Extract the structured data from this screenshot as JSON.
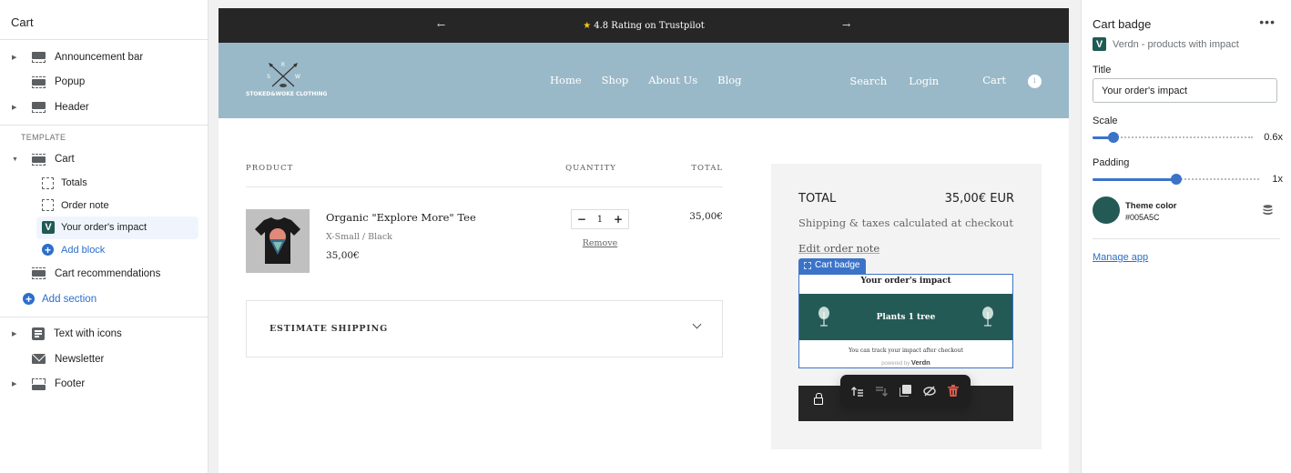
{
  "sidebar": {
    "title": "Cart",
    "header_sections": [
      {
        "label": "Announcement bar",
        "expandable": true,
        "icon": "section-top-icon"
      },
      {
        "label": "Popup",
        "expandable": false,
        "icon": "section-popup-icon"
      },
      {
        "label": "Header",
        "expandable": true,
        "icon": "section-top-icon"
      }
    ],
    "template_label": "TEMPLATE",
    "template_section": {
      "label": "Cart",
      "expanded": true
    },
    "blocks": [
      {
        "label": "Totals",
        "icon": "block-frame-icon"
      },
      {
        "label": "Order note",
        "icon": "block-frame-icon"
      },
      {
        "label": "Your order's impact",
        "icon": "verdn-app-icon",
        "selected": true
      }
    ],
    "add_block": "Add block",
    "cart_recommendations": "Cart recommendations",
    "add_section": "Add section",
    "footer_sections": [
      {
        "label": "Text with icons",
        "expandable": true,
        "icon": "text-icon"
      },
      {
        "label": "Newsletter",
        "expandable": false,
        "icon": "mail-icon"
      },
      {
        "label": "Footer",
        "expandable": true,
        "icon": "section-bottom-icon"
      }
    ]
  },
  "preview": {
    "announcement": {
      "text": "4.8 Rating on Trustpilot",
      "star": "★",
      "prev": "←",
      "next": "→"
    },
    "header": {
      "logo_text": "STOKED&WOKE CLOTHING",
      "logo_letters": {
        "top": "R",
        "left": "S",
        "right": "W"
      },
      "nav_left": [
        "Home",
        "Shop",
        "About Us",
        "Blog"
      ],
      "nav_right": {
        "search": "Search",
        "login": "Login",
        "cart": "Cart",
        "cart_count": "1"
      }
    },
    "cart": {
      "columns": {
        "product": "PRODUCT",
        "quantity": "QUANTITY",
        "total": "TOTAL"
      },
      "items": [
        {
          "name": "Organic \"Explore More\" Tee",
          "variant": "X-Small / Black",
          "price": "35,00€",
          "quantity": "1",
          "minus": "−",
          "plus": "+",
          "remove": "Remove",
          "line_total": "35,00€"
        }
      ],
      "estimate_shipping": "ESTIMATE SHIPPING"
    },
    "summary": {
      "total_label": "TOTAL",
      "total_value": "35,00€ EUR",
      "shipping_note": "Shipping & taxes calculated at checkout",
      "edit_note": "Edit order note",
      "selected_block_tab": "Cart badge",
      "badge": {
        "title": "Your order's impact",
        "impact": "Plants 1 tree",
        "track_note": "You can track your impact after checkout",
        "powered_by": "powered by",
        "brand": "Verdn"
      }
    },
    "block_toolbar": [
      {
        "name": "move-to-parent",
        "icon": "move-up-icon"
      },
      {
        "name": "move-down",
        "icon": "move-down-icon"
      },
      {
        "name": "duplicate",
        "icon": "duplicate-icon"
      },
      {
        "name": "hide",
        "icon": "hide-icon"
      },
      {
        "name": "delete",
        "icon": "trash-icon"
      }
    ]
  },
  "settings": {
    "title": "Cart badge",
    "more": "•••",
    "app_name": "Verdn - products with impact",
    "title_label": "Title",
    "title_value": "Your order's impact",
    "scale_label": "Scale",
    "scale_value": "0.6x",
    "scale_fraction": 0.13,
    "padding_label": "Padding",
    "padding_value": "1x",
    "padding_fraction": 0.5,
    "theme_color_label": "Theme color",
    "theme_color_value": "#005A5C",
    "theme_color_swatch": "#245a56",
    "manage_app": "Manage app"
  },
  "colors": {
    "accent": "#3b73c8",
    "link": "#2c6ecb",
    "header_bg": "#9ab9c8",
    "announcement_bg": "#262626",
    "badge_band": "#245a56",
    "delete": "#e05a4f"
  }
}
